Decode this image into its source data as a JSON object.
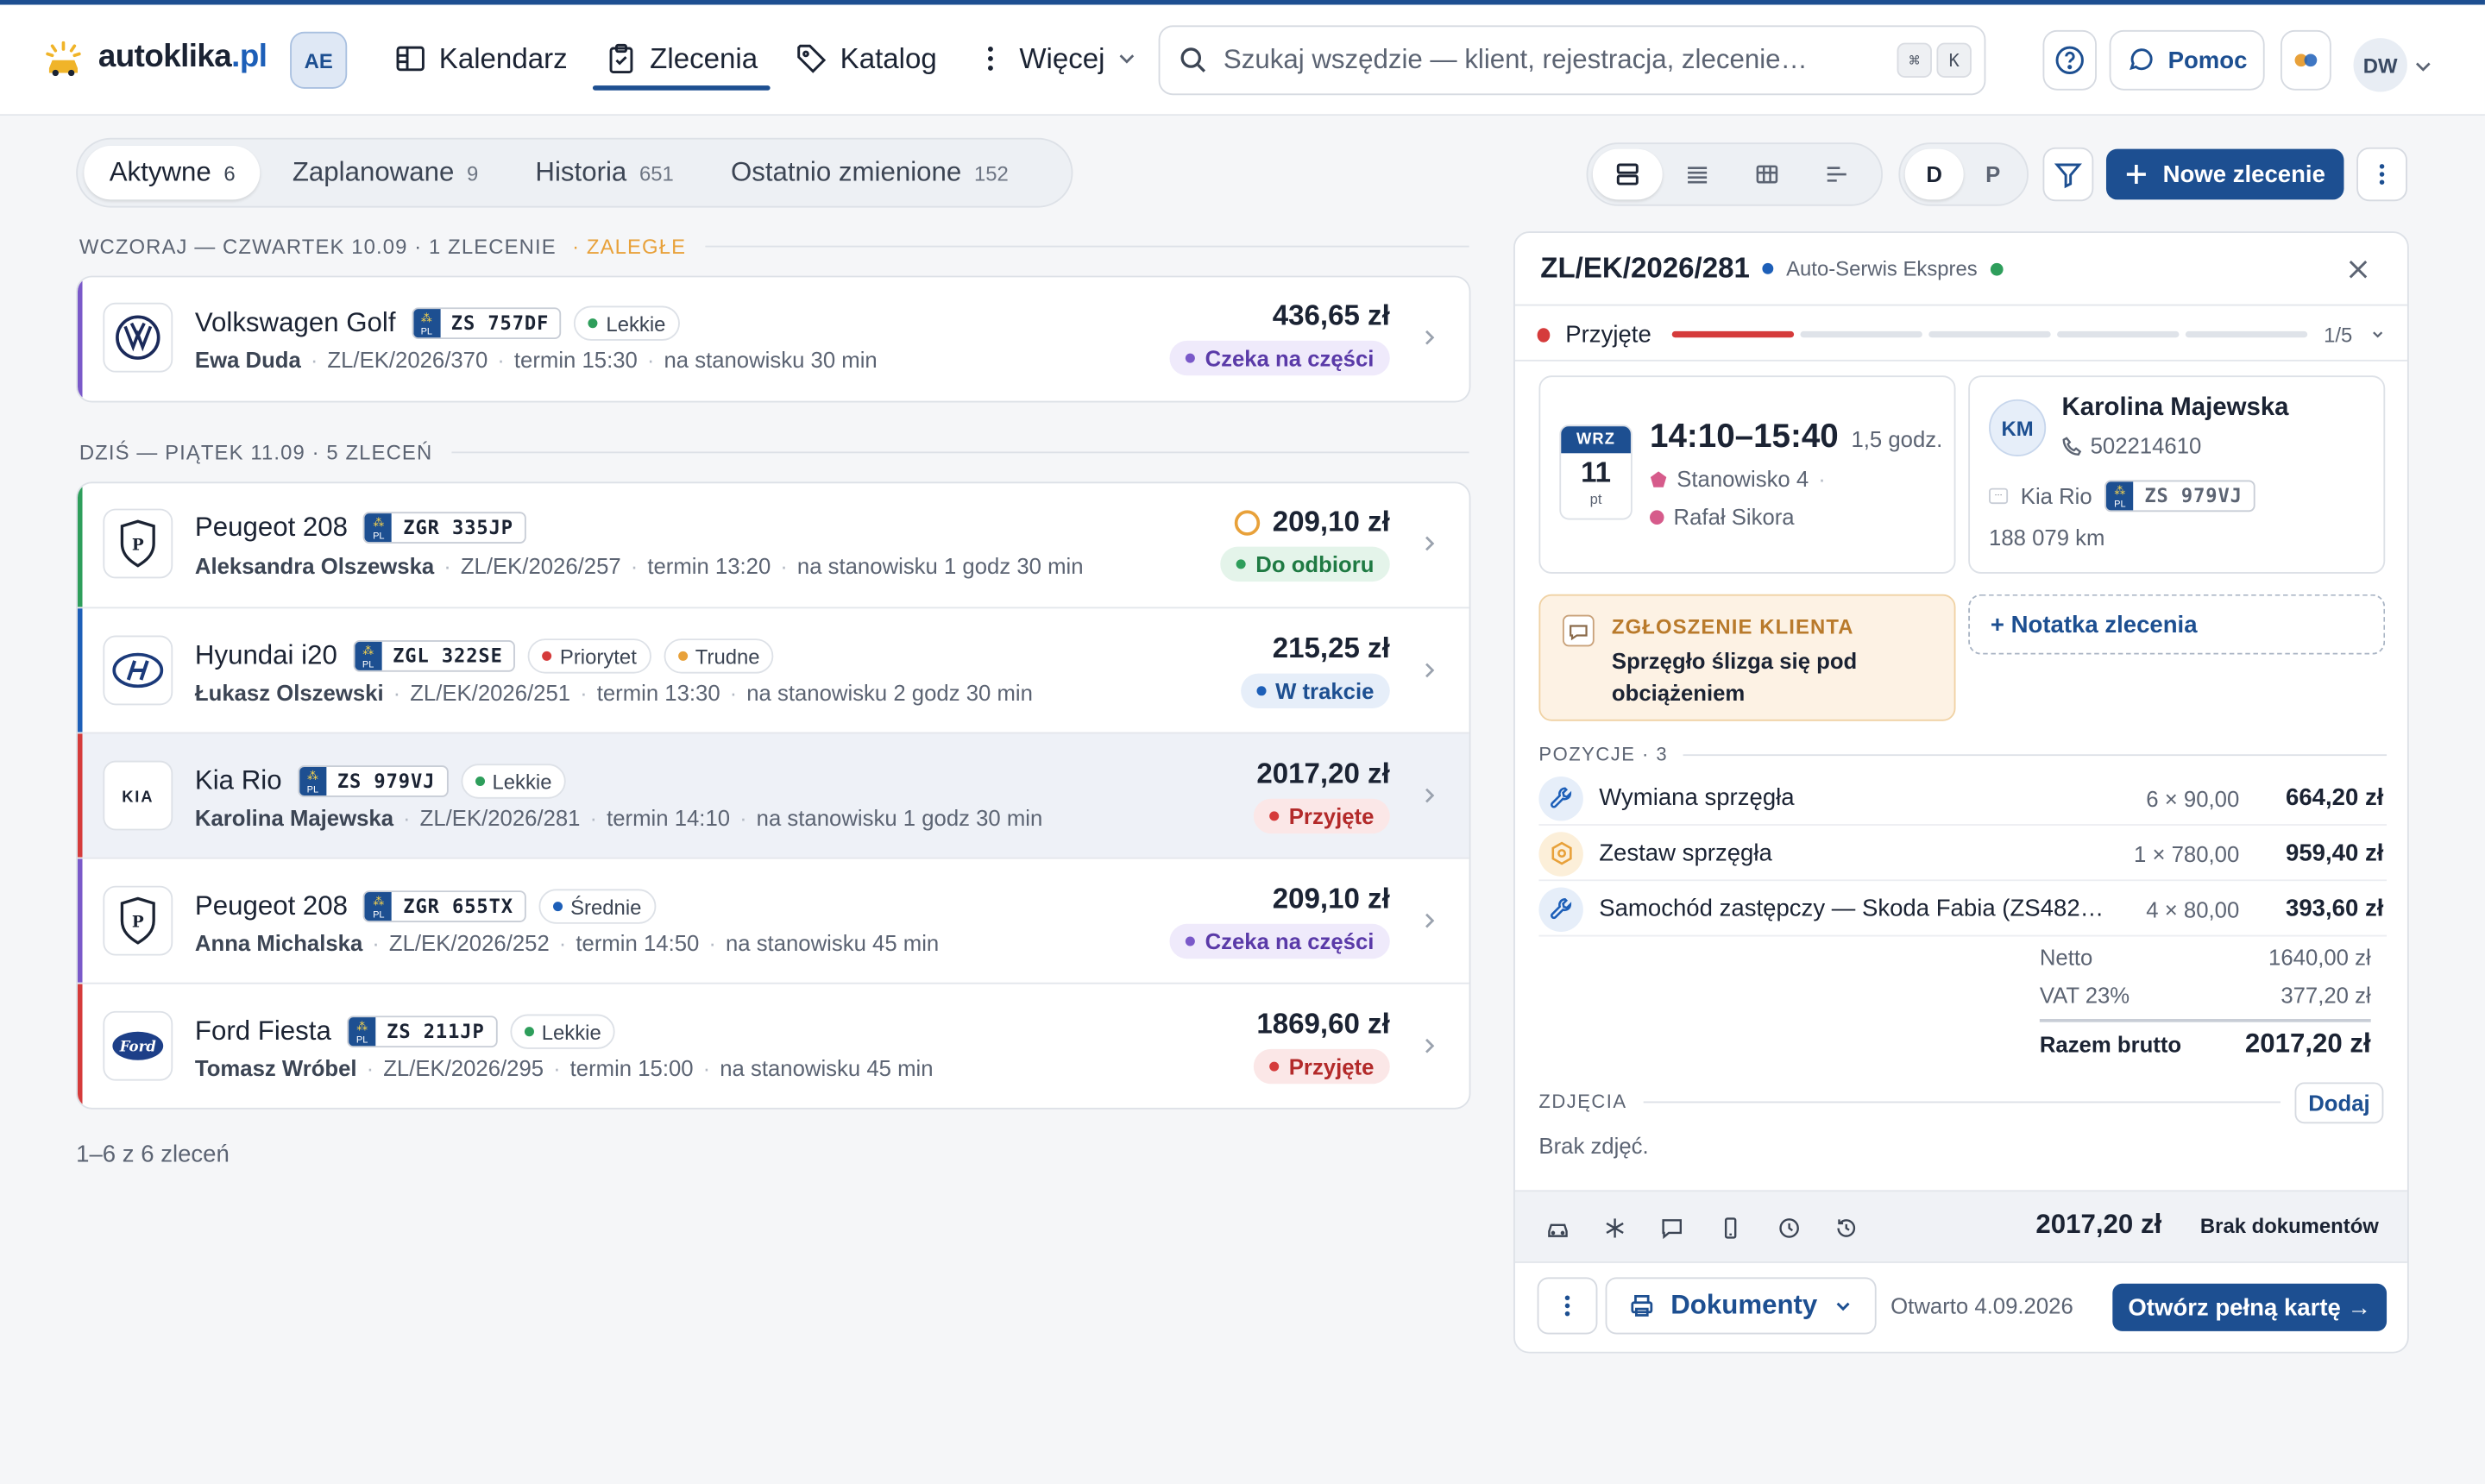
{
  "colors": {
    "primary": "#1d4f91",
    "red": "#d53b3b",
    "green": "#2e9e5b",
    "blue": "#1d5fb8",
    "purple": "#7a59c9",
    "orange": "#e8a13a"
  },
  "header": {
    "logo": "autoklika",
    "logo_suffix": ".pl",
    "workspace": "AE",
    "nav": [
      {
        "label": "Kalendarz",
        "icon": "calendar-icon",
        "active": false
      },
      {
        "label": "Zlecenia",
        "icon": "clipboard-icon",
        "active": true
      },
      {
        "label": "Katalog",
        "icon": "tag-icon",
        "active": false
      },
      {
        "label": "Więcej",
        "icon": "more-vertical-icon",
        "active": false
      }
    ],
    "search_placeholder": "Szukaj wszędzie — klient, rejestracja, zlecenie…",
    "shortcut_1": "⌘",
    "shortcut_2": "K",
    "help_label": "Pomoc",
    "user_initials": "DW"
  },
  "tabs": [
    {
      "label": "Aktywne",
      "count": "6",
      "active": true
    },
    {
      "label": "Zaplanowane",
      "count": "9"
    },
    {
      "label": "Historia",
      "count": "651"
    },
    {
      "label": "Ostatnio zmienione",
      "count": "152"
    }
  ],
  "toolbar": {
    "day": "D",
    "plan": "P",
    "new_order": "Nowe zlecenie"
  },
  "sections": {
    "yesterday": "WCZORAJ — CZWARTEK 10.09 · 1 ZLECENIE",
    "overdue": "· ZALEGŁE",
    "today": "DZIŚ — PIĄTEK 11.09 · 5 ZLECEŃ"
  },
  "orders": [
    {
      "brand": "VW",
      "model": "Volkswagen Golf",
      "plate": "ZS 757DF",
      "tags": [
        {
          "label": "Lekkie",
          "color": "#2e9e5b"
        }
      ],
      "client": "Ewa Duda",
      "number": "ZL/EK/2026/370",
      "due": "termin 15:30",
      "station": "na stanowisku 30 min",
      "price": "436,65 zł",
      "status": "Czeka na części",
      "status_color": "#7a59c9",
      "status_bg": "#efeafb",
      "status_fg": "#5a3aa8",
      "bar": "#7a59c9"
    },
    {
      "brand": "P",
      "model": "Peugeot 208",
      "plate": "ZGR 335JP",
      "tags": [],
      "client": "Aleksandra Olszewska",
      "number": "ZL/EK/2026/257",
      "due": "termin 13:20",
      "station": "na stanowisku 1 godz 30 min",
      "price": "209,10 zł",
      "status": "Do odbioru",
      "status_color": "#2e9e5b",
      "status_bg": "#e4f4ea",
      "status_fg": "#1f7a43",
      "bar": "#2e9e5b",
      "pending": true
    },
    {
      "brand": "H",
      "model": "Hyundai i20",
      "plate": "ZGL 322SE",
      "tags": [
        {
          "label": "Priorytet",
          "color": "#d53b3b"
        },
        {
          "label": "Trudne",
          "color": "#e8a13a"
        }
      ],
      "client": "Łukasz Olszewski",
      "number": "ZL/EK/2026/251",
      "due": "termin 13:30",
      "station": "na stanowisku 2 godz 30 min",
      "price": "215,25 zł",
      "status": "W trakcie",
      "status_color": "#1d5fb8",
      "status_bg": "#e6eef9",
      "status_fg": "#1d4f91",
      "bar": "#1d5fb8"
    },
    {
      "brand": "KIA",
      "model": "Kia Rio",
      "plate": "ZS 979VJ",
      "tags": [
        {
          "label": "Lekkie",
          "color": "#2e9e5b"
        }
      ],
      "client": "Karolina Majewska",
      "number": "ZL/EK/2026/281",
      "due": "termin 14:10",
      "station": "na stanowisku 1 godz 30 min",
      "price": "2017,20 zł",
      "status": "Przyjęte",
      "status_color": "#d53b3b",
      "status_bg": "#fbe7e7",
      "status_fg": "#b32a2a",
      "bar": "#d53b3b",
      "selected": true
    },
    {
      "brand": "P",
      "model": "Peugeot 208",
      "plate": "ZGR 655TX",
      "tags": [
        {
          "label": "Średnie",
          "color": "#1d5fb8"
        }
      ],
      "client": "Anna Michalska",
      "number": "ZL/EK/2026/252",
      "due": "termin 14:50",
      "station": "na stanowisku 45 min",
      "price": "209,10 zł",
      "status": "Czeka na części",
      "status_color": "#7a59c9",
      "status_bg": "#efeafb",
      "status_fg": "#5a3aa8",
      "bar": "#7a59c9"
    },
    {
      "brand": "Ford",
      "model": "Ford Fiesta",
      "plate": "ZS 211JP",
      "tags": [
        {
          "label": "Lekkie",
          "color": "#2e9e5b"
        }
      ],
      "client": "Tomasz Wróbel",
      "number": "ZL/EK/2026/295",
      "due": "termin 15:00",
      "station": "na stanowisku 45 min",
      "price": "1869,60 zł",
      "status": "Przyjęte",
      "status_color": "#d53b3b",
      "status_bg": "#fbe7e7",
      "status_fg": "#b32a2a",
      "bar": "#d53b3b"
    }
  ],
  "list_footer": "1–6 z 6 zleceń",
  "plate_country": "PL",
  "panel": {
    "number": "ZL/EK/2026/281",
    "org": "Auto-Serwis Ekspres",
    "stage": "Przyjęte",
    "stage_progress": "1/5",
    "stage_step": 1,
    "stage_total": 5,
    "cal_month": "WRZ",
    "cal_day": "11",
    "cal_weekday": "pt",
    "time": "14:10–15:40",
    "duration": "1,5 godz.",
    "station": "Stanowisko 4",
    "mechanic": "Rafał Sikora",
    "client_initials": "KM",
    "client_name": "Karolina Majewska",
    "client_phone": "502214610",
    "car": "Kia Rio",
    "plate": "ZS 979VJ",
    "mileage": "188 079 km",
    "complaint_label": "ZGŁOSZENIE KLIENTA",
    "complaint": "Sprzęgło ślizga się pod obciążeniem",
    "add_note": "+ Notatka zlecenia",
    "items_label": "POZYCJE · 3",
    "items": [
      {
        "name": "Wymiana sprzęgła",
        "qty": "6 × 90,00",
        "value": "664,20 zł",
        "icon": "wrench-icon"
      },
      {
        "name": "Zestaw sprzęgła",
        "qty": "1 × 780,00",
        "value": "959,40 zł",
        "icon": "part-icon"
      },
      {
        "name": "Samochód zastępczy — Skoda Fabia (ZS482…",
        "qty": "4 × 80,00",
        "value": "393,60 zł",
        "icon": "wrench-icon"
      }
    ],
    "net_label": "Netto",
    "net": "1640,00 zł",
    "vat_label": "VAT 23%",
    "vat": "377,20 zł",
    "gross_label": "Razem brutto",
    "gross": "2017,20 zł",
    "photos_label": "ZDJĘCIA",
    "photos_add": "Dodaj",
    "photos_empty": "Brak zdjęć.",
    "bar_total": "2017,20 zł",
    "bar_docs": "Brak dokumentów",
    "documents": "Dokumenty",
    "opened": "Otwarto 4.09.2026",
    "open_full": "Otwórz pełną kartę →"
  }
}
